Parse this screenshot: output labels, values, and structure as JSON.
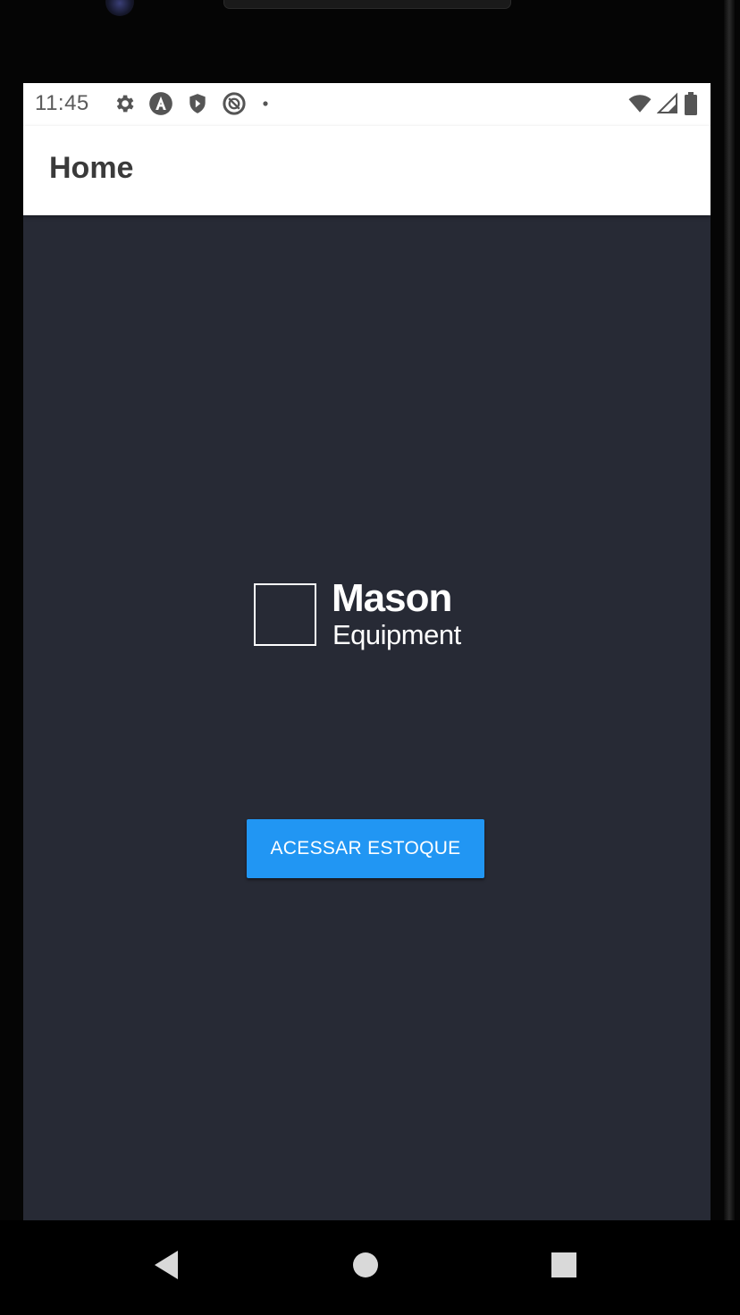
{
  "status_bar": {
    "time": "11:45",
    "icons_left": [
      "gear-icon",
      "app-a-icon",
      "shield-icon",
      "data-saver-icon",
      "notification-dot-icon"
    ],
    "icons_right": [
      "wifi-icon",
      "cell-signal-icon",
      "battery-icon"
    ]
  },
  "app_bar": {
    "title": "Home"
  },
  "logo": {
    "line1": "Mason",
    "line2": "Equipment"
  },
  "main": {
    "button_label": "ACESSAR ESTOQUE"
  },
  "nav_bar": {
    "buttons": [
      "back-icon",
      "home-icon",
      "recents-icon"
    ]
  },
  "colors": {
    "screen_background": "#272a35",
    "app_bar_background": "#ffffff",
    "button_color": "#2196f3",
    "title_color": "#3a3a3a"
  }
}
